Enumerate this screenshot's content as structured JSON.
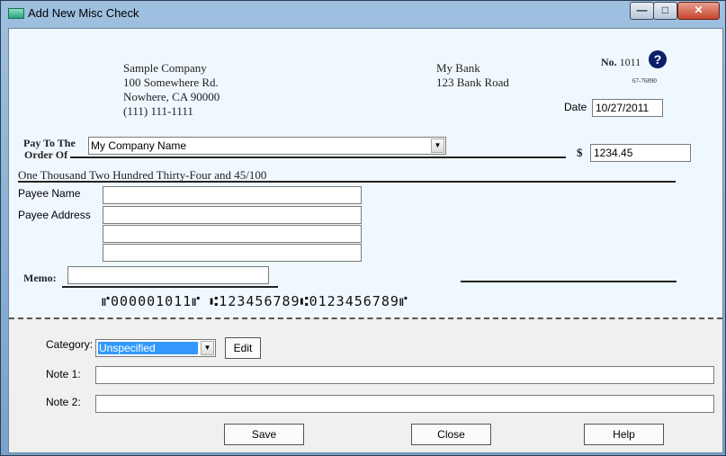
{
  "window": {
    "title": "Add New Misc Check",
    "minimize": "—",
    "maximize": "□",
    "close": "✕"
  },
  "check": {
    "company": {
      "name": "Sample Company",
      "address1": "100 Somewhere Rd.",
      "address2": "Nowhere, CA 90000",
      "phone": "(111) 111-1111"
    },
    "bank": {
      "name": "My Bank",
      "address": "123 Bank Road"
    },
    "number_label": "No.",
    "number": "1011",
    "routing_fraction": "67-76890",
    "help_symbol": "?",
    "date_label": "Date",
    "date_value": "10/27/2011",
    "pay_to_label1": "Pay To The",
    "pay_to_label2": "Order Of",
    "payee_selected": "My Company Name",
    "dollar_sign": "$",
    "amount": "1234.45",
    "amount_words": "One Thousand Two Hundred Thirty-Four and 45/100",
    "payee_name_label": "Payee Name",
    "payee_address_label": "Payee Address",
    "payee_name_value": "",
    "payee_address_lines": [
      "",
      "",
      ""
    ],
    "memo_label": "Memo:",
    "memo_value": "",
    "micr": "⑈000001011⑈ ⑆123456789⑆0123456789⑈"
  },
  "details": {
    "category_label": "Category:",
    "category_selected": "Unspecified",
    "edit_label": "Edit",
    "note1_label": "Note 1:",
    "note1_value": "",
    "note2_label": "Note 2:",
    "note2_value": ""
  },
  "buttons": {
    "save": "Save",
    "close": "Close",
    "help": "Help"
  },
  "colors": {
    "check_background": "#f0f8ff",
    "selection_highlight": "#3399ff",
    "help_icon": "#0b1e6b"
  }
}
